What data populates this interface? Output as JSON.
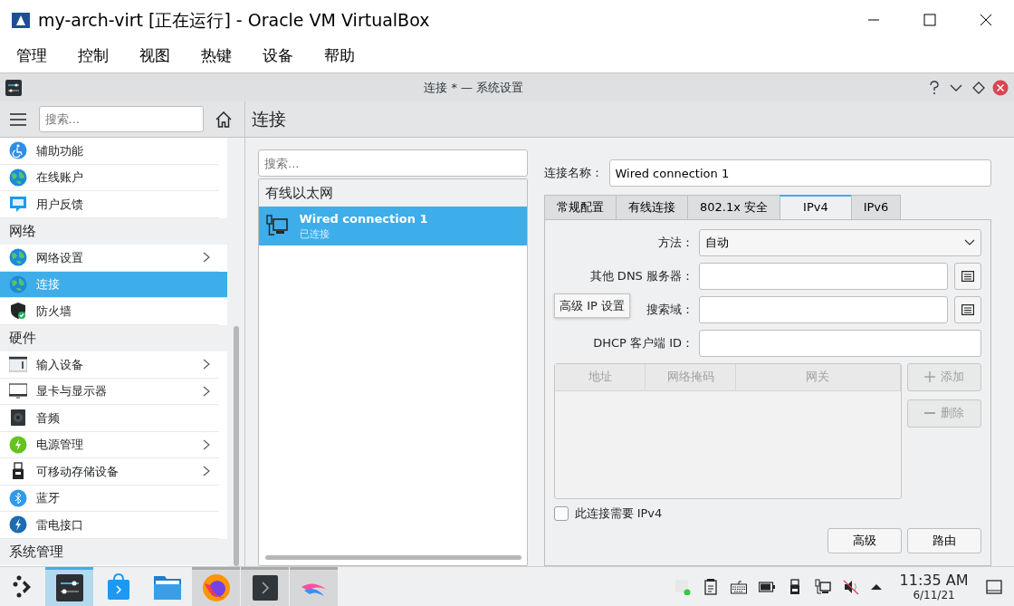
{
  "window": {
    "title": "my-arch-virt [正在运行] - Oracle VM VirtualBox"
  },
  "menu": [
    "管理",
    "控制",
    "视图",
    "热键",
    "设备",
    "帮助"
  ],
  "guest_window": {
    "title": "连接 * — 系统设置"
  },
  "sidebar": {
    "search_placeholder": "搜索...",
    "items": [
      {
        "kind": "item",
        "label": "辅助功能",
        "has_children": false,
        "selected": false
      },
      {
        "kind": "item",
        "label": "在线账户",
        "has_children": false,
        "selected": false
      },
      {
        "kind": "item",
        "label": "用户反馈",
        "has_children": false,
        "selected": false
      },
      {
        "kind": "header",
        "label": "网络"
      },
      {
        "kind": "item",
        "label": "网络设置",
        "has_children": true,
        "selected": false
      },
      {
        "kind": "item",
        "label": "连接",
        "has_children": false,
        "selected": true
      },
      {
        "kind": "item",
        "label": "防火墙",
        "has_children": false,
        "selected": false
      },
      {
        "kind": "header",
        "label": "硬件"
      },
      {
        "kind": "item",
        "label": "输入设备",
        "has_children": true,
        "selected": false
      },
      {
        "kind": "item",
        "label": "显卡与显示器",
        "has_children": true,
        "selected": false
      },
      {
        "kind": "item",
        "label": "音频",
        "has_children": false,
        "selected": false
      },
      {
        "kind": "item",
        "label": "电源管理",
        "has_children": true,
        "selected": false
      },
      {
        "kind": "item",
        "label": "可移动存储设备",
        "has_children": true,
        "selected": false
      },
      {
        "kind": "item",
        "label": "蓝牙",
        "has_children": false,
        "selected": false
      },
      {
        "kind": "item",
        "label": "雷电接口",
        "has_children": false,
        "selected": false
      },
      {
        "kind": "header",
        "label": "系统管理"
      }
    ]
  },
  "page_title": "连接",
  "connections": {
    "search_placeholder": "搜索...",
    "group": "有线以太网",
    "items": [
      {
        "name": "Wired connection 1",
        "status": "已连接",
        "selected": true
      }
    ]
  },
  "settings": {
    "name_label": "连接名称：",
    "name_value": "Wired connection 1",
    "tabs": [
      {
        "label": "常规配置",
        "selected": false
      },
      {
        "label": "有线连接",
        "selected": false
      },
      {
        "label": "802.1x 安全",
        "selected": false
      },
      {
        "label": "IPv4",
        "selected": true
      },
      {
        "label": "IPv6",
        "selected": false
      }
    ],
    "fields": [
      {
        "kind": "select",
        "label": "方法：",
        "value": "自动"
      },
      {
        "kind": "list",
        "label": "其他 DNS 服务器："
      },
      {
        "kind": "list",
        "label": "搜索域："
      },
      {
        "kind": "text",
        "label": "DHCP 客户端 ID："
      }
    ],
    "tooltip": "高级 IP 设置",
    "table": {
      "columns": [
        "地址",
        "网络掩码",
        "网关"
      ],
      "disabled": true
    },
    "side_buttons": [
      {
        "label": "添加",
        "disabled": true
      },
      {
        "label": "删除",
        "disabled": true
      }
    ],
    "checkbox": {
      "label": "此连接需要 IPv4",
      "checked": false
    },
    "buttons": [
      "高级",
      "路由"
    ]
  },
  "taskbar": {
    "tasks": [
      {
        "selected": true,
        "open": true
      },
      {
        "selected": false,
        "open": false
      },
      {
        "selected": false,
        "open": false
      },
      {
        "selected": false,
        "open": true
      },
      {
        "selected": false,
        "open": true
      },
      {
        "selected": false,
        "open": true
      }
    ],
    "time": "11:35 AM",
    "date": "6/11/21"
  }
}
